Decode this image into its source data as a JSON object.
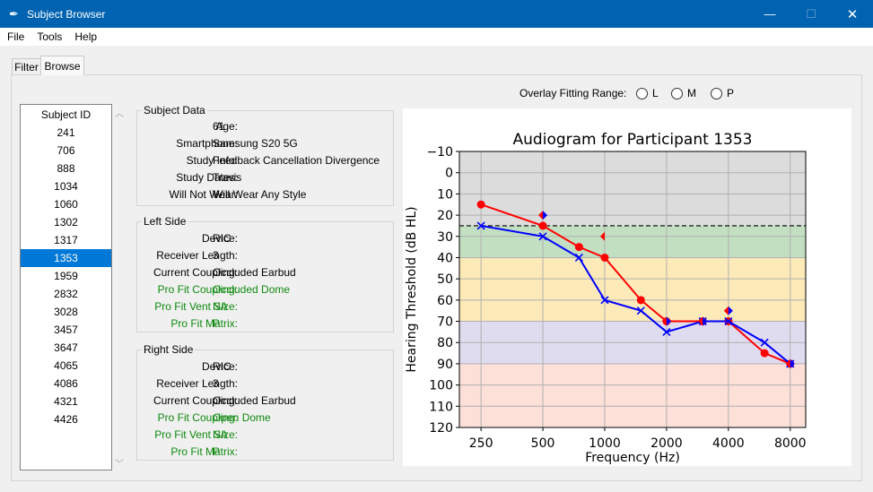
{
  "window": {
    "title": "Subject Browser",
    "minimize": "—",
    "maximize": "☐",
    "close": "✕"
  },
  "menu": [
    "File",
    "Tools",
    "Help"
  ],
  "tabs": [
    "Filter",
    "Browse"
  ],
  "subject_list": {
    "header": "Subject ID",
    "items": [
      "241",
      "706",
      "888",
      "1034",
      "1060",
      "1302",
      "1317",
      "1353",
      "1959",
      "2832",
      "3028",
      "3457",
      "3647",
      "4065",
      "4086",
      "4321",
      "4426"
    ],
    "selected": "1353"
  },
  "subject_data": {
    "title": "Subject Data",
    "rows": [
      {
        "key": "Age:",
        "value": "61"
      },
      {
        "key": "Smartphone:",
        "value": "Samsung S20 5G"
      },
      {
        "key": "Study Info:",
        "value": "Feedback Cancellation Divergence"
      },
      {
        "key": "Study Dates:",
        "value": "Travis"
      },
      {
        "key": "Will Not Wear:",
        "value": "Will Wear Any Style"
      }
    ]
  },
  "left_side": {
    "title": "Left Side",
    "rows": [
      {
        "key": "Device:",
        "value": "RIC",
        "green": false
      },
      {
        "key": "Receiver Length:",
        "value": "3",
        "green": false
      },
      {
        "key": "Current Coupling:",
        "value": "Occluded Earbud",
        "green": false
      },
      {
        "key": "Pro Fit Coupling:",
        "value": "Occluded Dome",
        "green": true
      },
      {
        "key": "Pro Fit Vent Size:",
        "value": "NA",
        "green": true
      },
      {
        "key": "Pro Fit Matrix:",
        "value": "P",
        "green": true
      }
    ]
  },
  "right_side": {
    "title": "Right Side",
    "rows": [
      {
        "key": "Device:",
        "value": "RIC",
        "green": false
      },
      {
        "key": "Receiver Length:",
        "value": "3",
        "green": false
      },
      {
        "key": "Current Coupling:",
        "value": "Occluded Earbud",
        "green": false
      },
      {
        "key": "Pro Fit Coupling:",
        "value": "Open Dome",
        "green": true
      },
      {
        "key": "Pro Fit Vent Size:",
        "value": "NA",
        "green": true
      },
      {
        "key": "Pro Fit Matrix:",
        "value": "P",
        "green": true
      }
    ]
  },
  "overlay": {
    "label": "Overlay Fitting Range:",
    "options": [
      "L",
      "M",
      "P"
    ]
  },
  "chart_data": {
    "type": "line",
    "title": "Audiogram for Participant 1353",
    "xlabel": "Frequency (Hz)",
    "ylabel": "Hearing Threshold (dB HL)",
    "x_scale": "log",
    "x_ticks": [
      250,
      500,
      1000,
      2000,
      4000,
      8000
    ],
    "y_ticks": [
      -10,
      0,
      10,
      20,
      30,
      40,
      50,
      60,
      70,
      80,
      90,
      100,
      110,
      120
    ],
    "ylim": [
      120,
      -10
    ],
    "y_inverted": true,
    "grid": true,
    "reference_line": {
      "y": 25,
      "style": "dashed",
      "color": "#000000"
    },
    "bands": [
      {
        "from": -10,
        "to": 25,
        "color": "#dcdcdc"
      },
      {
        "from": 25,
        "to": 40,
        "color": "#c3dfc1"
      },
      {
        "from": 40,
        "to": 70,
        "color": "#fdeab9"
      },
      {
        "from": 70,
        "to": 90,
        "color": "#e0dcf0"
      },
      {
        "from": 90,
        "to": 120,
        "color": "#fde0d8"
      }
    ],
    "series": [
      {
        "color": "#ff0000",
        "marker": "circle",
        "x": [
          250,
          500,
          750,
          1000,
          1500,
          2000,
          3000,
          4000,
          6000,
          8000
        ],
        "y": [
          15,
          25,
          35,
          40,
          60,
          70,
          70,
          70,
          85,
          90
        ]
      },
      {
        "color": "#0000ff",
        "marker": "x",
        "x": [
          250,
          500,
          750,
          1000,
          1500,
          2000,
          3000,
          4000,
          6000,
          8000
        ],
        "y": [
          25,
          30,
          40,
          60,
          65,
          75,
          70,
          70,
          80,
          90
        ]
      }
    ],
    "bone_conduction_markers": [
      {
        "x": 500,
        "y": 20,
        "ear": "both"
      },
      {
        "x": 1000,
        "y": 30,
        "ear": "right"
      },
      {
        "x": 2000,
        "y": 70,
        "ear": "both"
      },
      {
        "x": 3000,
        "y": 70,
        "ear": "both"
      },
      {
        "x": 4000,
        "y": 65,
        "ear": "both"
      },
      {
        "x": 8000,
        "y": 90,
        "ear": "both"
      }
    ]
  }
}
